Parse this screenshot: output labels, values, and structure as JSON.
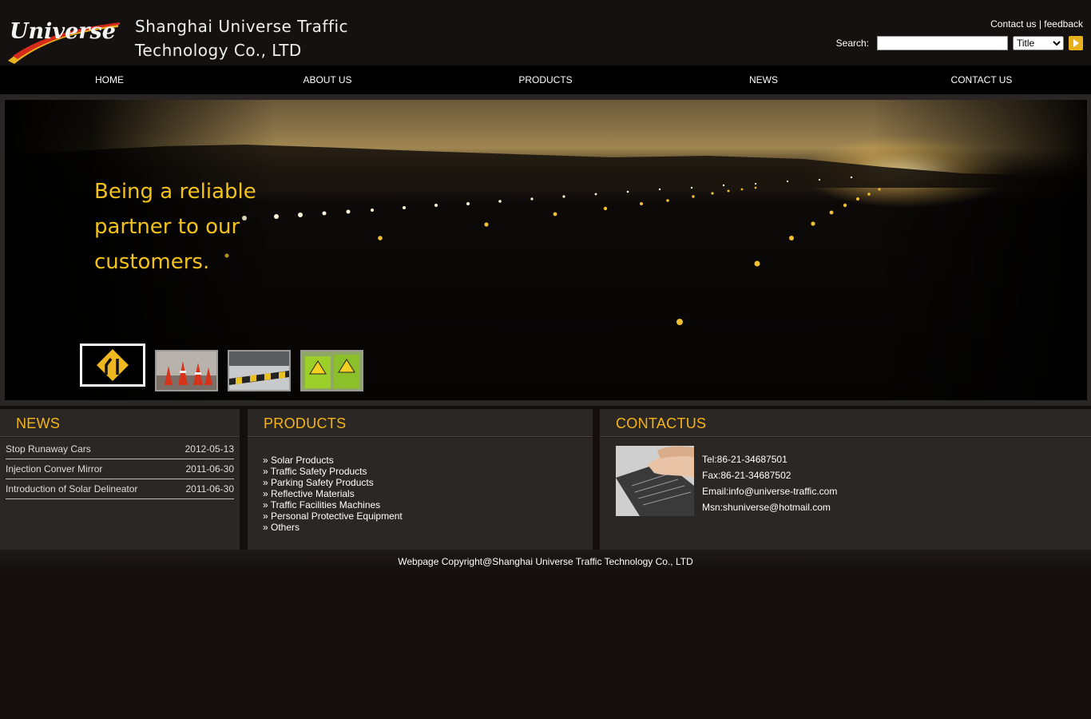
{
  "header": {
    "logo_text": "Universe",
    "company_line1": "Shanghai Universe Traffic",
    "company_line2": "Technology Co., LTD",
    "contact_link": "Contact us",
    "separator": " | ",
    "feedback_link": "feedback",
    "search_label": "Search:",
    "search_value": "",
    "search_scope": "Title",
    "search_scope_options": [
      "Title"
    ]
  },
  "nav": [
    "HOME",
    "ABOUT US",
    "PRODUCTS",
    "NEWS",
    "CONTACT US"
  ],
  "banner": {
    "slogan": [
      "Being a reliable",
      "partner to our",
      "customers."
    ],
    "thumbnails": [
      "lane-merge-sign",
      "traffic-cones",
      "speed-bump",
      "warning-signs"
    ],
    "active_index": 0
  },
  "news": {
    "title": "NEWS",
    "items": [
      {
        "title": "Stop Runaway Cars",
        "date": "2012-05-13"
      },
      {
        "title": "Injection Conver Mirror",
        "date": "2011-06-30"
      },
      {
        "title": "Introduction of Solar Delineator",
        "date": "2011-06-30"
      }
    ]
  },
  "products": {
    "title": "PRODUCTS",
    "items": [
      "» Solar Products",
      "» Traffic Safety Products",
      "» Parking Safety Products",
      "» Reflective Materials",
      "» Traffic Facilities Machines",
      "» Personal Protective Equipment",
      "» Others"
    ]
  },
  "contact": {
    "title": "CONTACTUS",
    "tel": "Tel:86-21-34687501",
    "fax": "Fax:86-21-34687502",
    "email": "Email:info@universe-traffic.com",
    "msn": "Msn:shuniverse@hotmail.com"
  },
  "footer": {
    "copyright": "Webpage Copyright@Shanghai Universe Traffic Technology Co., LTD"
  },
  "colors": {
    "accent": "#f5b416",
    "slogan": "#f2c21a",
    "background": "#140f0c",
    "panel": "#2b2725",
    "nav": "#000000"
  }
}
